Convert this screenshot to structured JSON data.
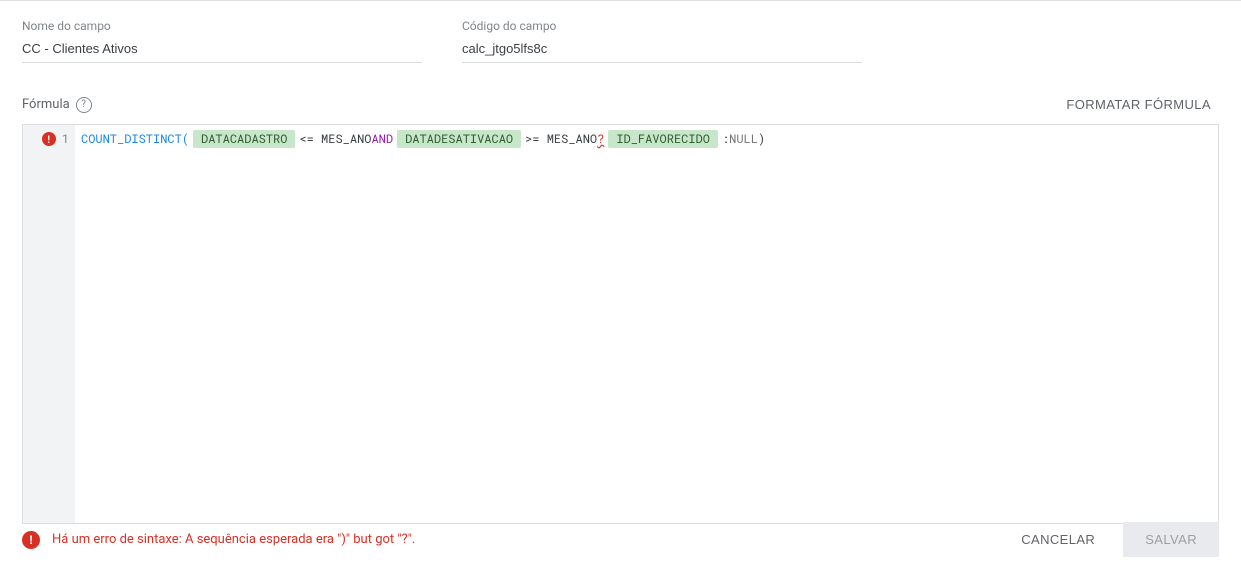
{
  "fields": {
    "name_label": "Nome do campo",
    "name_value": "CC - Clientes Ativos",
    "code_label": "Código do campo",
    "code_value": "calc_jtgo5lfs8c"
  },
  "formula": {
    "label": "Fórmula",
    "help_glyph": "?",
    "format_button": "FORMATAR FÓRMULA",
    "line_number": "1",
    "gutter_error_glyph": "!",
    "tokens": {
      "fn_open": "COUNT_DISTINCT(",
      "field1": "DATACADASTRO",
      "op1": " <= MES_ANO ",
      "kw_and": "AND",
      "field2": "DATADESATIVACAO",
      "op2": " >= MES_ANO ",
      "err_q": "?",
      "field3": "ID_FAVORECIDO",
      "colon": " : ",
      "null_tok": "NULL",
      "close": ")"
    }
  },
  "error": {
    "icon_glyph": "!",
    "message": "Há um erro de sintaxe: A sequência esperada era \")\" but got \"?\"."
  },
  "buttons": {
    "cancel": "CANCELAR",
    "save": "SALVAR"
  }
}
